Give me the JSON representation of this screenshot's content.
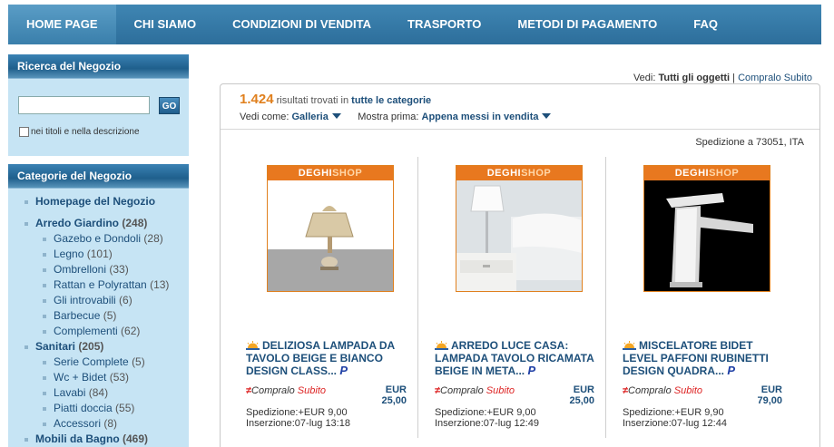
{
  "nav": {
    "items": [
      {
        "label": "HOME PAGE"
      },
      {
        "label": "CHI SIAMO"
      },
      {
        "label": "CONDIZIONI DI VENDITA"
      },
      {
        "label": "TRASPORTO"
      },
      {
        "label": "METODI DI PAGAMENTO"
      },
      {
        "label": "FAQ"
      }
    ]
  },
  "search": {
    "title": "Ricerca del Negozio",
    "input_value": "",
    "go_label": "GO",
    "checkbox_label": "nei titoli e nella descrizione"
  },
  "categories": {
    "title": "Categorie del Negozio",
    "items": [
      {
        "label": "Homepage del Negozio",
        "count": ""
      },
      {
        "label": "Arredo Giardino",
        "count": "(248)"
      },
      {
        "label": "Gazebo e Dondoli",
        "count": "(28)"
      },
      {
        "label": "Legno",
        "count": "(101)"
      },
      {
        "label": "Ombrelloni",
        "count": "(33)"
      },
      {
        "label": "Rattan e Polyrattan",
        "count": "(13)"
      },
      {
        "label": "Gli introvabili",
        "count": "(6)"
      },
      {
        "label": "Barbecue",
        "count": "(5)"
      },
      {
        "label": "Complementi",
        "count": "(62)"
      },
      {
        "label": "Sanitari",
        "count": "(205)"
      },
      {
        "label": "Serie Complete",
        "count": "(5)"
      },
      {
        "label": "Wc + Bidet",
        "count": "(53)"
      },
      {
        "label": "Lavabi",
        "count": "(84)"
      },
      {
        "label": "Piatti doccia",
        "count": "(55)"
      },
      {
        "label": "Accessori",
        "count": "(8)"
      },
      {
        "label": "Mobili da Bagno",
        "count": "(469)"
      }
    ]
  },
  "view": {
    "prefix": "Vedi:",
    "current": "Tutti gli oggetti",
    "sep": "|",
    "alt": "Compralo Subito"
  },
  "results": {
    "count": "1.424",
    "found_text": "risultati trovati in",
    "category": "tutte le categorie",
    "view_label": "Vedi come:",
    "view_value": "Galleria",
    "sort_label": "Mostra prima:",
    "sort_value": "Appena messi in vendita",
    "shipping_to": "Spedizione a 73051, ITA"
  },
  "items": [
    {
      "brand_a": "DEGHI",
      "brand_b": "SHOP",
      "title": "DELIZIOSA LAMPADA DA TAVOLO BEIGE E BIANCO DESIGN CLASS...",
      "pp": "P",
      "bin_a": "Compralo",
      "bin_b": "Subito",
      "currency": "EUR",
      "price": "25,00",
      "shipping": "Spedizione:+EUR 9,00",
      "listed": "Inserzione:07-lug 13:18"
    },
    {
      "brand_a": "DEGHI",
      "brand_b": "SHOP",
      "title": "ARREDO LUCE CASA: LAMPADA TAVOLO RICAMATA BEIGE IN META...",
      "pp": "P",
      "bin_a": "Compralo",
      "bin_b": "Subito",
      "currency": "EUR",
      "price": "25,00",
      "shipping": "Spedizione:+EUR 9,00",
      "listed": "Inserzione:07-lug 12:49"
    },
    {
      "brand_a": "DEGHI",
      "brand_b": "SHOP",
      "title": "MISCELATORE BIDET LEVEL PAFFONI RUBINETTI DESIGN QUADRA...",
      "pp": "P",
      "bin_a": "Compralo",
      "bin_b": "Subito",
      "currency": "EUR",
      "price": "79,00",
      "shipping": "Spedizione:+EUR 9,90",
      "listed": "Inserzione:07-lug 12:44"
    }
  ]
}
